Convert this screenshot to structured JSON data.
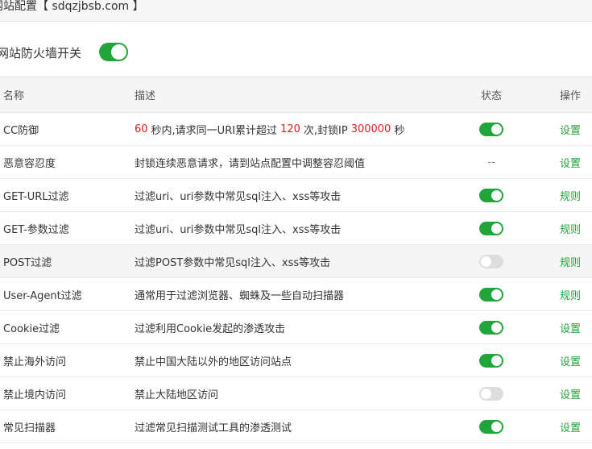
{
  "header": {
    "title": "网站配置【 sdqzjbsb.com 】"
  },
  "firewall_master": {
    "label": "网站防火墙开关",
    "enabled": true
  },
  "columns": {
    "name": "名称",
    "desc": "描述",
    "state": "状态",
    "op": "操作"
  },
  "cc": {
    "prefix_num": "60",
    "t1": "秒内,请求同一URI累计超过",
    "count": "120",
    "t2": "次,封锁IP",
    "block": "300000",
    "t3": "秒"
  },
  "rows": [
    {
      "name": "CC防御",
      "desc": "",
      "state": "on",
      "op": "设置"
    },
    {
      "name": "恶意容忍度",
      "desc": "封锁连续恶意请求，请到站点配置中调整容忍阈值",
      "state": "--",
      "op": "设置"
    },
    {
      "name": "GET-URL过滤",
      "desc": "过滤uri、uri参数中常见sql注入、xss等攻击",
      "state": "on",
      "op": "规则"
    },
    {
      "name": "GET-参数过滤",
      "desc": "过滤uri、uri参数中常见sql注入、xss等攻击",
      "state": "on",
      "op": "规则"
    },
    {
      "name": "POST过滤",
      "desc": "过滤POST参数中常见sql注入、xss等攻击",
      "state": "off",
      "op": "规则"
    },
    {
      "name": "User-Agent过滤",
      "desc": "通常用于过滤浏览器、蜘蛛及一些自动扫描器",
      "state": "on",
      "op": "规则"
    },
    {
      "name": "Cookie过滤",
      "desc": "过滤利用Cookie发起的渗透攻击",
      "state": "on",
      "op": "设置"
    },
    {
      "name": "禁止海外访问",
      "desc": "禁止中国大陆以外的地区访问站点",
      "state": "on",
      "op": "设置"
    },
    {
      "name": "禁止境内访问",
      "desc": "禁止大陆地区访问",
      "state": "off",
      "op": "设置"
    },
    {
      "name": "常见扫描器",
      "desc": "过滤常见扫描测试工具的渗透测试",
      "state": "on",
      "op": "设置"
    }
  ],
  "colors": {
    "accent": "#20a53a",
    "number": "#e02020",
    "toggle_off": "#dddddd"
  }
}
